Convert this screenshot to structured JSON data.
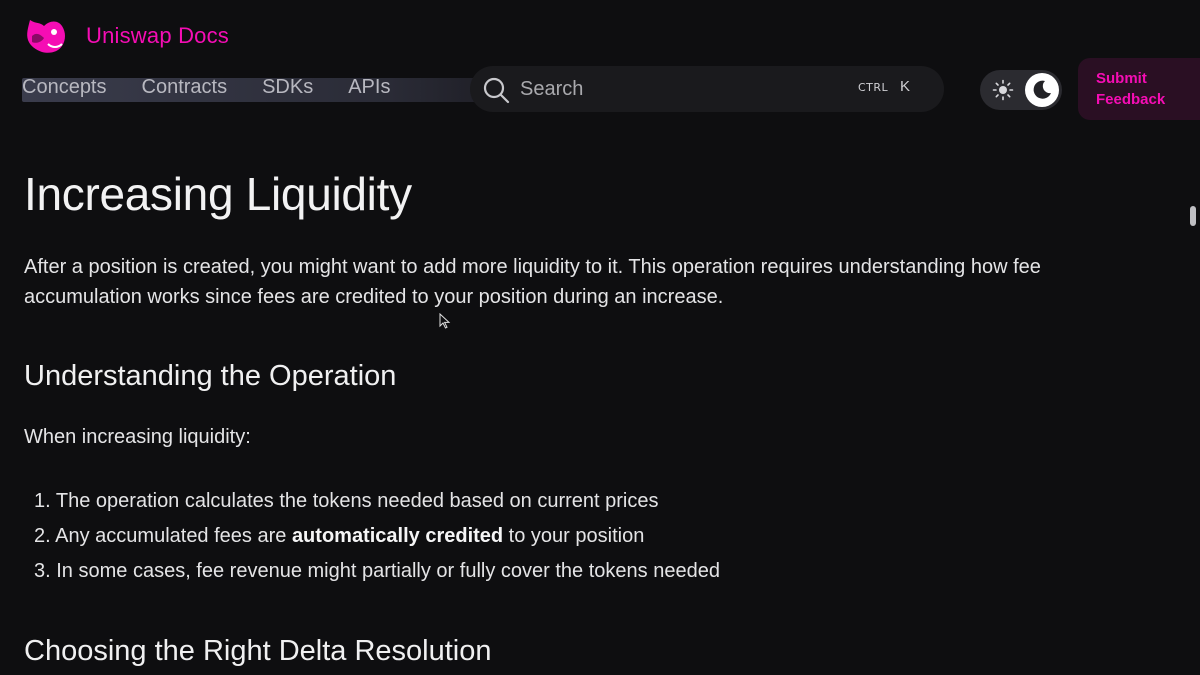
{
  "header": {
    "brand_name": "Uniswap Docs",
    "nav": [
      "Concepts",
      "Contracts",
      "SDKs",
      "APIs"
    ],
    "search": {
      "placeholder": "Search",
      "shortcut_modifier": "CTRL",
      "shortcut_key": "K"
    },
    "theme": {
      "mode": "dark"
    },
    "feedback_line1": "Submit",
    "feedback_line2": "Feedback"
  },
  "article": {
    "title": "Increasing Liquidity",
    "intro": "After a position is created, you might want to add more liquidity to it. This operation requires understanding how fee accumulation works since fees are credited to your position during an increase.",
    "section1_title": "Understanding the Operation",
    "section1_lead": "When increasing liquidity:",
    "steps": [
      {
        "num": "1.",
        "before": "The operation calculates the tokens needed based on current prices",
        "bold": "",
        "after": ""
      },
      {
        "num": "2.",
        "before": "Any accumulated fees are ",
        "bold": "automatically credited",
        "after": " to your position"
      },
      {
        "num": "3.",
        "before": "In some cases, fee revenue might partially or fully cover the tokens needed",
        "bold": "",
        "after": ""
      }
    ],
    "section2_title": "Choosing the Right Delta Resolution"
  },
  "colors": {
    "accent": "#f50db4",
    "background": "#0e0e10"
  }
}
